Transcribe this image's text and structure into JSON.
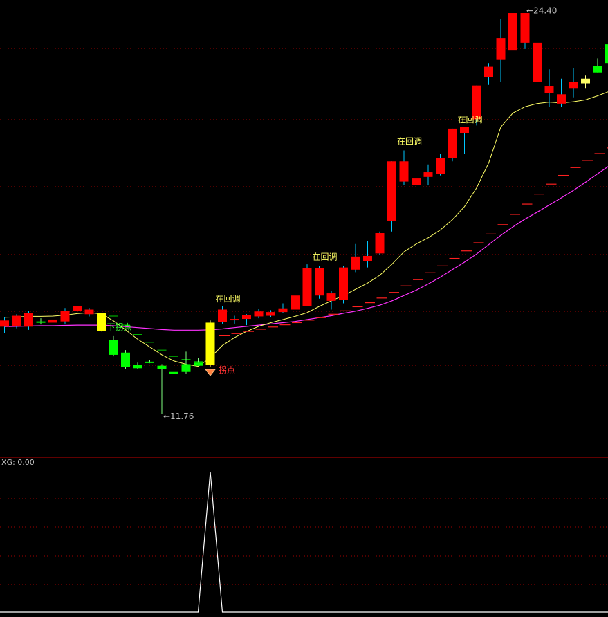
{
  "chart_data": [
    {
      "type": "candlestick",
      "title": "",
      "ylim": [
        10.5,
        24.8
      ],
      "colors": {
        "up": "#ff0000",
        "down": "#00ff00",
        "signal": "#ffff00",
        "ma_short": "#ffff66",
        "ma_long": "#ff33ff",
        "trail": "#ff2020",
        "grid": "#a00000"
      },
      "candles": [
        {
          "o": 14.55,
          "h": 14.85,
          "l": 14.35,
          "c": 14.75,
          "type": "up"
        },
        {
          "o": 14.58,
          "h": 14.95,
          "l": 14.5,
          "c": 14.9,
          "type": "up"
        },
        {
          "o": 14.55,
          "h": 15.05,
          "l": 14.45,
          "c": 14.98,
          "type": "up"
        },
        {
          "o": 14.72,
          "h": 14.82,
          "l": 14.62,
          "c": 14.68,
          "type": "down"
        },
        {
          "o": 14.68,
          "h": 14.8,
          "l": 14.6,
          "c": 14.78,
          "type": "up"
        },
        {
          "o": 14.72,
          "h": 15.15,
          "l": 14.65,
          "c": 15.05,
          "type": "up"
        },
        {
          "o": 15.05,
          "h": 15.3,
          "l": 14.95,
          "c": 15.2,
          "type": "up"
        },
        {
          "o": 14.95,
          "h": 15.15,
          "l": 14.88,
          "c": 15.1,
          "type": "up"
        },
        {
          "o": 14.98,
          "h": 15.0,
          "l": 14.4,
          "c": 14.42,
          "type": "signal"
        },
        {
          "o": 14.12,
          "h": 14.25,
          "l": 13.6,
          "c": 13.65,
          "type": "down"
        },
        {
          "o": 13.72,
          "h": 13.8,
          "l": 13.2,
          "c": 13.25,
          "type": "down"
        },
        {
          "o": 13.32,
          "h": 13.4,
          "l": 13.2,
          "c": 13.22,
          "type": "down"
        },
        {
          "o": 13.43,
          "h": 13.48,
          "l": 13.38,
          "c": 13.42,
          "type": "down"
        },
        {
          "o": 13.3,
          "h": 13.35,
          "l": 11.76,
          "c": 13.2,
          "type": "down"
        },
        {
          "o": 13.1,
          "h": 13.2,
          "l": 13.0,
          "c": 13.04,
          "type": "down"
        },
        {
          "o": 13.1,
          "h": 13.75,
          "l": 13.05,
          "c": 13.35,
          "type": "down"
        },
        {
          "o": 13.4,
          "h": 13.55,
          "l": 13.3,
          "c": 13.3,
          "type": "down"
        },
        {
          "o": 13.32,
          "h": 14.75,
          "l": 13.25,
          "c": 14.68,
          "type": "signal"
        },
        {
          "o": 14.7,
          "h": 15.2,
          "l": 14.65,
          "c": 15.1,
          "type": "up"
        },
        {
          "o": 14.76,
          "h": 14.9,
          "l": 14.65,
          "c": 14.8,
          "type": "up"
        },
        {
          "o": 14.8,
          "h": 14.95,
          "l": 14.6,
          "c": 14.92,
          "type": "up"
        },
        {
          "o": 14.88,
          "h": 15.12,
          "l": 14.82,
          "c": 15.04,
          "type": "up"
        },
        {
          "o": 14.9,
          "h": 15.08,
          "l": 14.85,
          "c": 15.02,
          "type": "up"
        },
        {
          "o": 15.02,
          "h": 15.3,
          "l": 15.0,
          "c": 15.14,
          "type": "up"
        },
        {
          "o": 15.1,
          "h": 15.75,
          "l": 15.05,
          "c": 15.55,
          "type": "up"
        },
        {
          "o": 15.22,
          "h": 16.55,
          "l": 15.2,
          "c": 16.42,
          "type": "up"
        },
        {
          "o": 15.55,
          "h": 16.5,
          "l": 15.45,
          "c": 16.44,
          "type": "up"
        },
        {
          "o": 15.38,
          "h": 15.7,
          "l": 15.1,
          "c": 15.62,
          "type": "up"
        },
        {
          "o": 15.4,
          "h": 16.5,
          "l": 15.3,
          "c": 16.45,
          "type": "up"
        },
        {
          "o": 16.38,
          "h": 17.2,
          "l": 16.3,
          "c": 16.8,
          "type": "up"
        },
        {
          "o": 16.65,
          "h": 17.3,
          "l": 16.45,
          "c": 16.82,
          "type": "up"
        },
        {
          "o": 16.9,
          "h": 17.6,
          "l": 16.85,
          "c": 17.55,
          "type": "up"
        },
        {
          "o": 17.95,
          "h": 19.85,
          "l": 17.6,
          "c": 19.85,
          "type": "up"
        },
        {
          "o": 19.2,
          "h": 20.2,
          "l": 19.1,
          "c": 19.85,
          "type": "up"
        },
        {
          "o": 19.1,
          "h": 19.6,
          "l": 19.0,
          "c": 19.3,
          "type": "up"
        },
        {
          "o": 19.35,
          "h": 19.75,
          "l": 19.1,
          "c": 19.5,
          "type": "up"
        },
        {
          "o": 19.45,
          "h": 20.1,
          "l": 19.4,
          "c": 19.95,
          "type": "up"
        },
        {
          "o": 19.95,
          "h": 20.88,
          "l": 19.85,
          "c": 20.9,
          "type": "up"
        },
        {
          "o": 20.75,
          "h": 20.92,
          "l": 20.1,
          "c": 20.95,
          "type": "up"
        },
        {
          "o": 21.2,
          "h": 21.2,
          "l": 21.0,
          "c": 22.28,
          "type": "up"
        },
        {
          "o": 22.55,
          "h": 23.0,
          "l": 22.3,
          "c": 22.88,
          "type": "up"
        },
        {
          "o": 23.1,
          "h": 24.4,
          "l": 22.4,
          "c": 23.8,
          "type": "up"
        },
        {
          "o": 23.4,
          "h": 23.8,
          "l": 23.1,
          "c": 24.6,
          "type": "up"
        },
        {
          "o": 23.65,
          "h": 24.55,
          "l": 23.45,
          "c": 24.6,
          "type": "up"
        },
        {
          "o": 22.4,
          "h": 22.55,
          "l": 21.9,
          "c": 23.65,
          "type": "up"
        },
        {
          "o": 22.25,
          "h": 22.8,
          "l": 21.6,
          "c": 22.05,
          "type": "up"
        },
        {
          "o": 21.7,
          "h": 22.5,
          "l": 21.6,
          "c": 22.0,
          "type": "up"
        },
        {
          "o": 22.2,
          "h": 22.85,
          "l": 21.9,
          "c": 22.4,
          "type": "up"
        },
        {
          "o": 22.5,
          "h": 22.6,
          "l": 22.2,
          "c": 22.35,
          "type": "neutral"
        },
        {
          "o": 22.9,
          "h": 23.15,
          "l": 22.9,
          "c": 22.7,
          "type": "down"
        },
        {
          "o": 23.6,
          "h": 23.6,
          "l": 23.0,
          "c": 23.0,
          "type": "down"
        }
      ],
      "ma_short": [
        14.85,
        14.86,
        14.88,
        14.88,
        14.89,
        14.92,
        14.97,
        15.0,
        14.96,
        14.74,
        14.45,
        14.15,
        13.9,
        13.65,
        13.45,
        13.35,
        13.28,
        13.55,
        13.95,
        14.2,
        14.4,
        14.56,
        14.68,
        14.78,
        14.88,
        15.0,
        15.2,
        15.38,
        15.55,
        15.75,
        15.95,
        16.2,
        16.55,
        16.95,
        17.2,
        17.4,
        17.65,
        17.98,
        18.4,
        19.0,
        19.8,
        20.95,
        21.4,
        21.6,
        21.7,
        21.75,
        21.72,
        21.76,
        21.82,
        21.95,
        22.1
      ],
      "ma_long": [
        14.55,
        14.56,
        14.57,
        14.58,
        14.58,
        14.59,
        14.6,
        14.6,
        14.6,
        14.58,
        14.55,
        14.52,
        14.49,
        14.46,
        14.44,
        14.44,
        14.44,
        14.45,
        14.48,
        14.52,
        14.56,
        14.6,
        14.64,
        14.68,
        14.72,
        14.78,
        14.84,
        14.9,
        14.98,
        15.05,
        15.14,
        15.24,
        15.38,
        15.55,
        15.72,
        15.92,
        16.14,
        16.38,
        16.62,
        16.88,
        17.18,
        17.48,
        17.75,
        18.0,
        18.22,
        18.45,
        18.68,
        18.92,
        19.18,
        19.45,
        19.72
      ],
      "trail": [
        null,
        null,
        null,
        null,
        null,
        null,
        null,
        null,
        null,
        null,
        null,
        null,
        null,
        null,
        null,
        null,
        null,
        null,
        14.26,
        14.33,
        14.4,
        14.47,
        14.54,
        14.61,
        14.68,
        14.76,
        14.84,
        14.95,
        15.06,
        15.19,
        15.32,
        15.47,
        15.65,
        15.86,
        16.06,
        16.28,
        16.5,
        16.74,
        16.98,
        17.24,
        17.52,
        17.82,
        18.15,
        18.48,
        18.8,
        19.12,
        19.4,
        19.65,
        19.88,
        20.1,
        20.28
      ],
      "annotations": {
        "high_label": "24.40",
        "low_label": "11.76",
        "down_turn_label": "下拐点",
        "turn_label": "拐点",
        "pullback_label": "在回调"
      }
    },
    {
      "type": "line",
      "label_name": "XG",
      "label_value": "0.00",
      "ylim": [
        0,
        1
      ],
      "values": [
        0,
        0,
        0,
        0,
        0,
        0,
        0,
        0,
        0,
        0,
        0,
        0,
        0,
        0,
        0,
        0,
        0,
        1,
        0,
        0,
        0,
        0,
        0,
        0,
        0,
        0,
        0,
        0,
        0,
        0,
        0,
        0,
        0,
        0,
        0,
        0,
        0,
        0,
        0,
        0,
        0,
        0,
        0,
        0,
        0,
        0,
        0,
        0,
        0,
        0,
        0
      ]
    }
  ]
}
